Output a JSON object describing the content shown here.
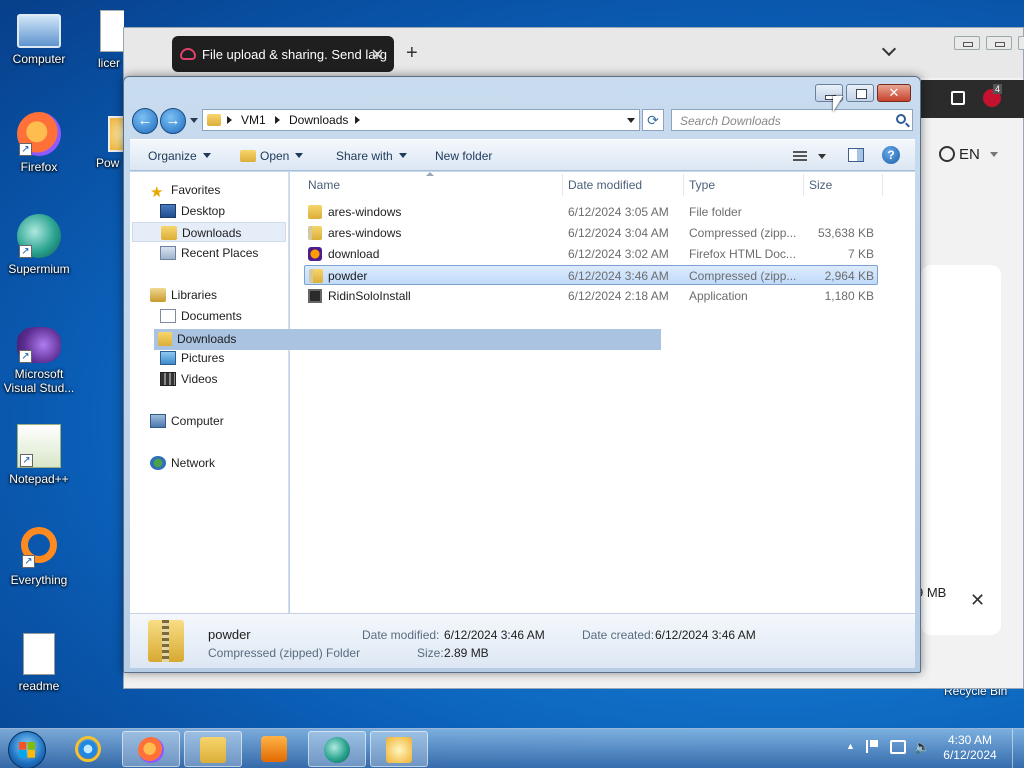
{
  "desktop": {
    "icons": [
      {
        "label": "Computer"
      },
      {
        "label": "licer"
      },
      {
        "label": "Firefox"
      },
      {
        "label": "Pow"
      },
      {
        "label": "Supermium"
      },
      {
        "label": "Microsoft Visual Stud..."
      },
      {
        "label": "Notepad++"
      },
      {
        "label": "Everything"
      },
      {
        "label": "readme"
      }
    ],
    "recycle_bin": "Recycle Bin"
  },
  "browser": {
    "tab_title": "File upload & sharing. Send larg",
    "tab_close": "✕",
    "new_tab": "+",
    "language": "EN",
    "badge": "4",
    "notification_size": "9 MB",
    "notification_close": "✕"
  },
  "explorer": {
    "title_buttons": {
      "close": "✕"
    },
    "address": {
      "crumbs": [
        "VM1",
        "Downloads"
      ]
    },
    "search_placeholder": "Search Downloads",
    "toolbar": {
      "organize": "Organize",
      "open": "Open",
      "share_with": "Share with",
      "new_folder": "New folder",
      "help": "?"
    },
    "nav": {
      "favorites": "Favorites",
      "desktop": "Desktop",
      "downloads": "Downloads",
      "recent_places": "Recent Places",
      "libraries": "Libraries",
      "documents": "Documents",
      "lib_downloads": "Downloads",
      "pictures": "Pictures",
      "videos": "Videos",
      "computer": "Computer",
      "network": "Network"
    },
    "columns": {
      "name": "Name",
      "date": "Date modified",
      "type": "Type",
      "size": "Size"
    },
    "files": [
      {
        "icon": "folder-icon",
        "name": "ares-windows",
        "date": "6/12/2024 3:05 AM",
        "type": "File folder",
        "size": ""
      },
      {
        "icon": "zip-icon",
        "name": "ares-windows",
        "date": "6/12/2024 3:04 AM",
        "type": "Compressed (zipp...",
        "size": "53,638 KB"
      },
      {
        "icon": "firefox-html-icon",
        "name": "download",
        "date": "6/12/2024 3:02 AM",
        "type": "Firefox HTML Doc...",
        "size": "7 KB"
      },
      {
        "icon": "zip-icon",
        "name": "powder",
        "date": "6/12/2024 3:46 AM",
        "type": "Compressed (zipp...",
        "size": "2,964 KB",
        "selected": true
      },
      {
        "icon": "application-icon",
        "name": "RidinSoloInstall",
        "date": "6/12/2024 2:18 AM",
        "type": "Application",
        "size": "1,180 KB"
      }
    ],
    "details": {
      "name": "powder",
      "kind": "Compressed (zipped) Folder",
      "date_modified_label": "Date modified:",
      "date_modified": "6/12/2024 3:46 AM",
      "date_created_label": "Date created:",
      "date_created": "6/12/2024 3:46 AM",
      "size_label": "Size:",
      "size": "2.89 MB"
    }
  },
  "taskbar": {
    "clock_time": "4:30 AM",
    "clock_date": "6/12/2024",
    "tray_up": "▲"
  }
}
